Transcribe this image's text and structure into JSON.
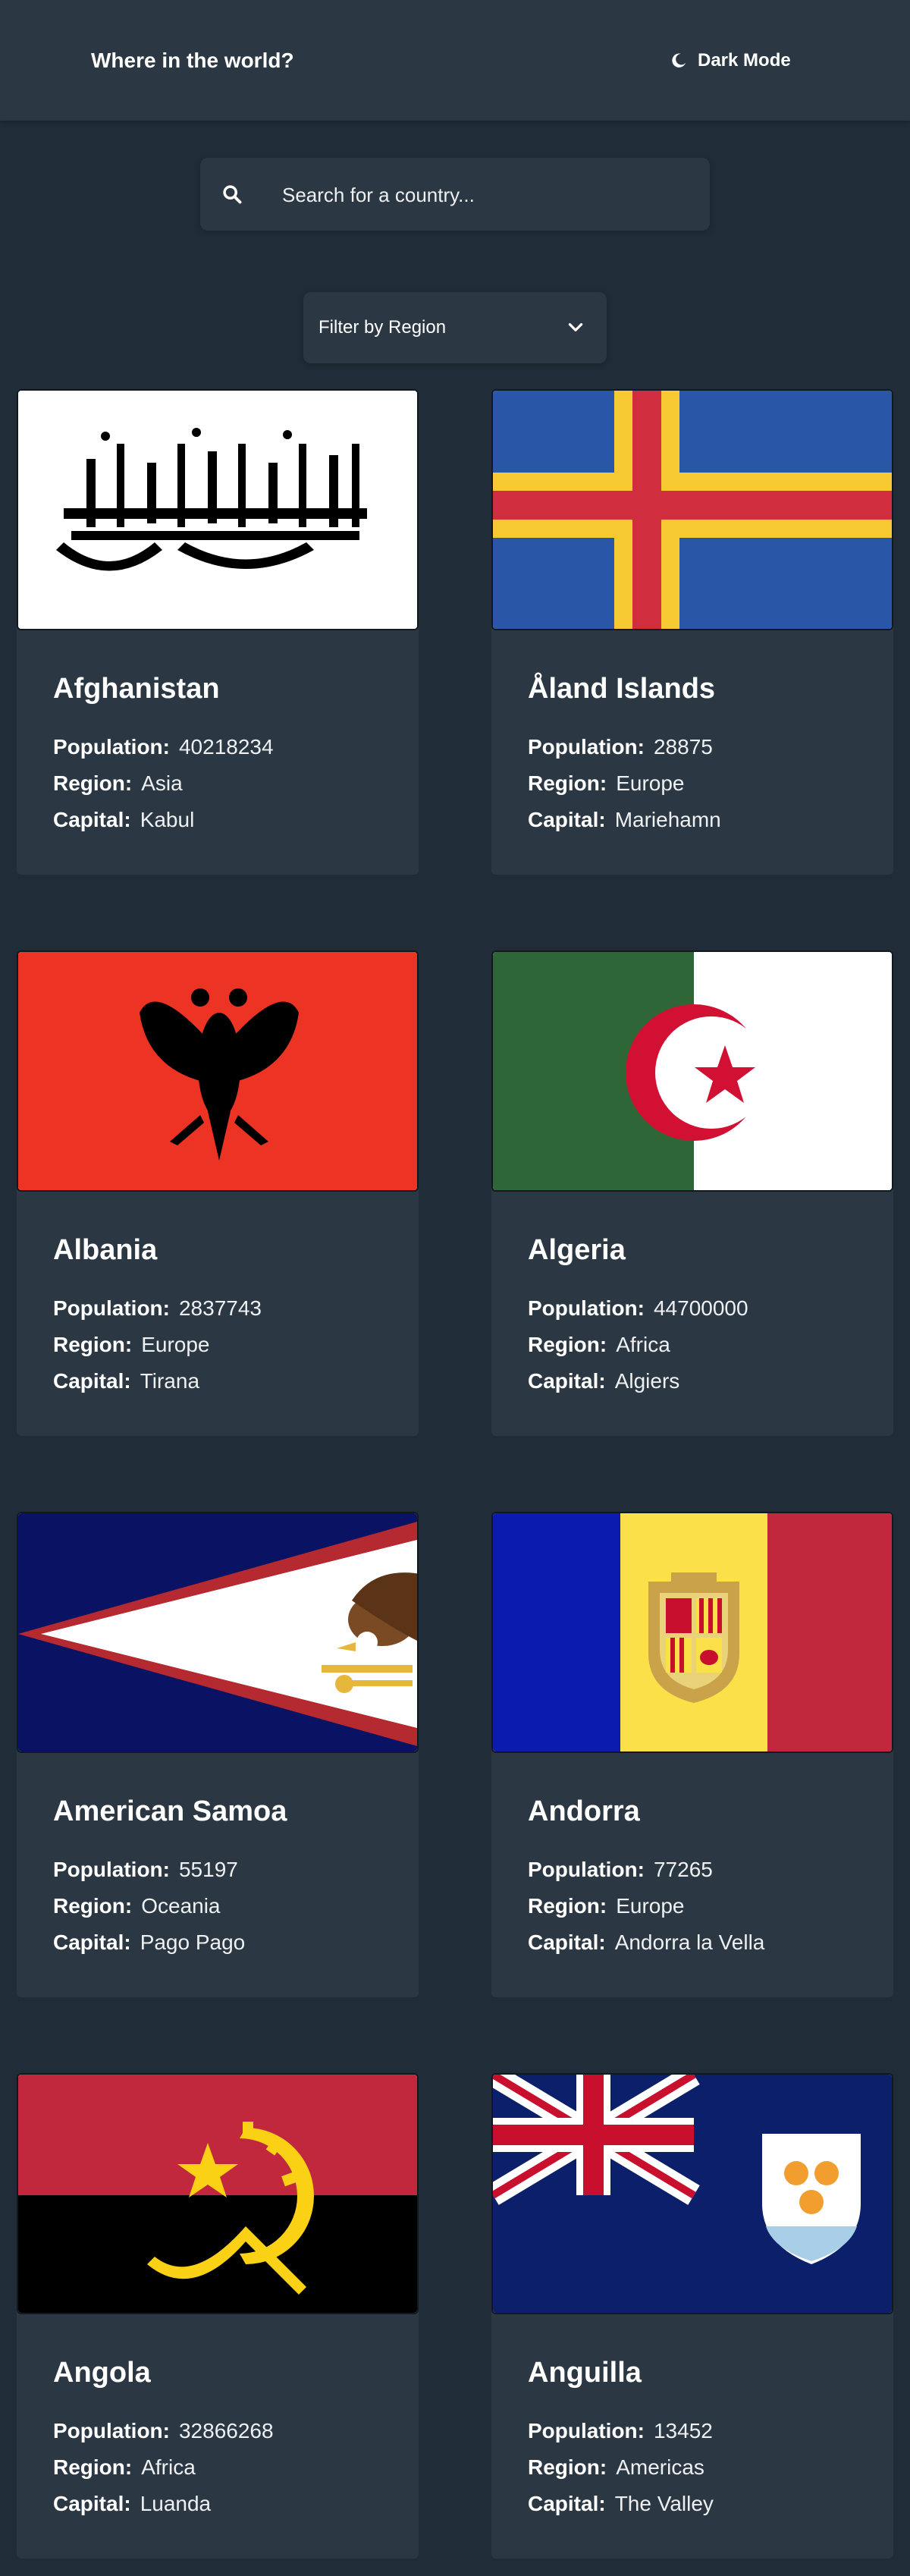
{
  "header": {
    "title": "Where in the world?",
    "mode_label": "Dark Mode",
    "mode_icon": "moon-icon"
  },
  "search": {
    "placeholder": "Search for a country...",
    "value": ""
  },
  "filter": {
    "label": "Filter by Region"
  },
  "labels": {
    "population": "Population:",
    "region": "Region:",
    "capital": "Capital:"
  },
  "colors": {
    "background": "#202c37",
    "element": "#2b3743",
    "text": "#ffffff"
  },
  "countries": [
    {
      "name": "Afghanistan",
      "population": "40218234",
      "region": "Asia",
      "capital": "Kabul",
      "flag": "afghanistan-flag"
    },
    {
      "name": "Åland Islands",
      "population": "28875",
      "region": "Europe",
      "capital": "Mariehamn",
      "flag": "aland-islands-flag"
    },
    {
      "name": "Albania",
      "population": "2837743",
      "region": "Europe",
      "capital": "Tirana",
      "flag": "albania-flag"
    },
    {
      "name": "Algeria",
      "population": "44700000",
      "region": "Africa",
      "capital": "Algiers",
      "flag": "algeria-flag"
    },
    {
      "name": "American Samoa",
      "population": "55197",
      "region": "Oceania",
      "capital": "Pago Pago",
      "flag": "american-samoa-flag"
    },
    {
      "name": "Andorra",
      "population": "77265",
      "region": "Europe",
      "capital": "Andorra la Vella",
      "flag": "andorra-flag"
    },
    {
      "name": "Angola",
      "population": "32866268",
      "region": "Africa",
      "capital": "Luanda",
      "flag": "angola-flag"
    },
    {
      "name": "Anguilla",
      "population": "13452",
      "region": "Americas",
      "capital": "The Valley",
      "flag": "anguilla-flag"
    }
  ]
}
